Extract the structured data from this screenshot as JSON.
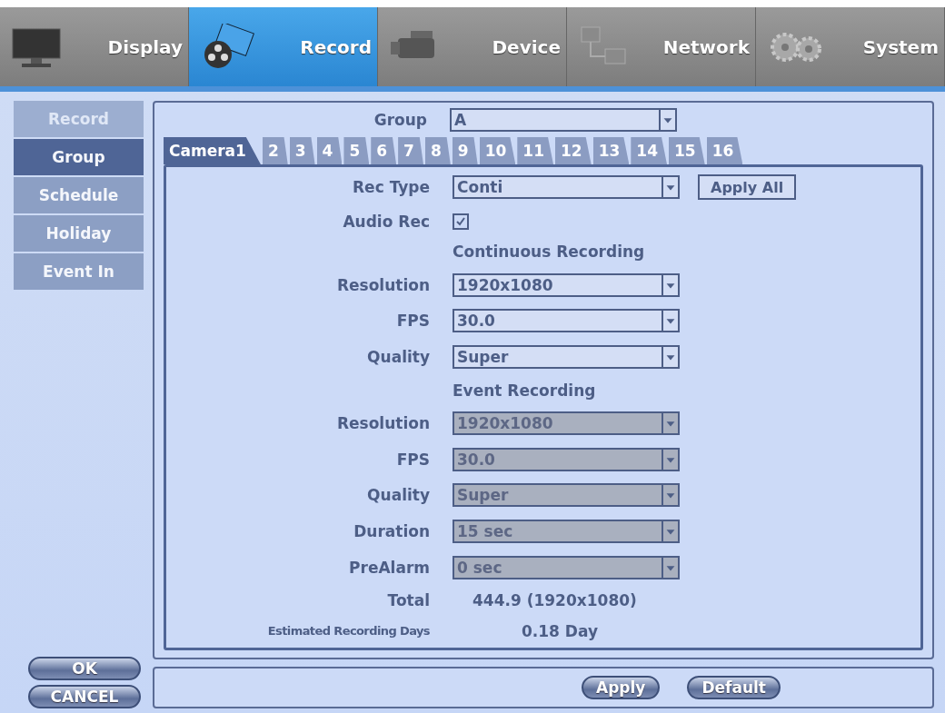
{
  "top_tabs": [
    {
      "label": "Display",
      "kind": "monitor",
      "selected": false
    },
    {
      "label": "Record",
      "kind": "film",
      "selected": true
    },
    {
      "label": "Device",
      "kind": "camera",
      "selected": false
    },
    {
      "label": "Network",
      "kind": "network",
      "selected": false
    },
    {
      "label": "System",
      "kind": "gears",
      "selected": false
    }
  ],
  "sidebar": {
    "items": [
      {
        "label": "Record",
        "selected": false,
        "disabled": true
      },
      {
        "label": "Group",
        "selected": true,
        "disabled": false
      },
      {
        "label": "Schedule",
        "selected": false,
        "disabled": false
      },
      {
        "label": "Holiday",
        "selected": false,
        "disabled": false
      },
      {
        "label": "Event In",
        "selected": false,
        "disabled": false
      }
    ],
    "buttons": [
      "OK",
      "CANCEL"
    ]
  },
  "group": {
    "label": "Group",
    "value": "A"
  },
  "camera_tabs": [
    {
      "label": "Camera1",
      "selected": true
    },
    {
      "label": "2",
      "selected": false
    },
    {
      "label": "3",
      "selected": false
    },
    {
      "label": "4",
      "selected": false
    },
    {
      "label": "5",
      "selected": false
    },
    {
      "label": "6",
      "selected": false
    },
    {
      "label": "7",
      "selected": false
    },
    {
      "label": "8",
      "selected": false
    },
    {
      "label": "9",
      "selected": false
    },
    {
      "label": "10",
      "selected": false
    },
    {
      "label": "11",
      "selected": false
    },
    {
      "label": "12",
      "selected": false
    },
    {
      "label": "13",
      "selected": false
    },
    {
      "label": "14",
      "selected": false
    },
    {
      "label": "15",
      "selected": false
    },
    {
      "label": "16",
      "selected": false
    }
  ],
  "rows": [
    {
      "kind": "select",
      "label": "Rec Type",
      "value": "Conti",
      "disabled": false,
      "button": "Apply All"
    },
    {
      "kind": "checkbox",
      "label": "Audio Rec",
      "checked": true
    },
    {
      "kind": "heading",
      "value": "Continuous Recording"
    },
    {
      "kind": "select",
      "label": "Resolution",
      "value": "1920x1080",
      "disabled": false
    },
    {
      "kind": "select",
      "label": "FPS",
      "value": "30.0",
      "disabled": false
    },
    {
      "kind": "select",
      "label": "Quality",
      "value": "Super",
      "disabled": false
    },
    {
      "kind": "heading",
      "value": "Event Recording"
    },
    {
      "kind": "select",
      "label": "Resolution",
      "value": "1920x1080",
      "disabled": true
    },
    {
      "kind": "select",
      "label": "FPS",
      "value": "30.0",
      "disabled": true
    },
    {
      "kind": "select",
      "label": "Quality",
      "value": "Super",
      "disabled": true
    },
    {
      "kind": "select",
      "label": "Duration",
      "value": "15 sec",
      "disabled": true
    },
    {
      "kind": "select",
      "label": "PreAlarm",
      "value": "0 sec",
      "disabled": true
    },
    {
      "kind": "text",
      "label": "Total",
      "value": "444.9 (1920x1080)"
    },
    {
      "kind": "small",
      "label": "Estimated Recording Days",
      "value": "0.18 Day"
    }
  ],
  "footer_buttons": [
    "Apply",
    "Default"
  ]
}
